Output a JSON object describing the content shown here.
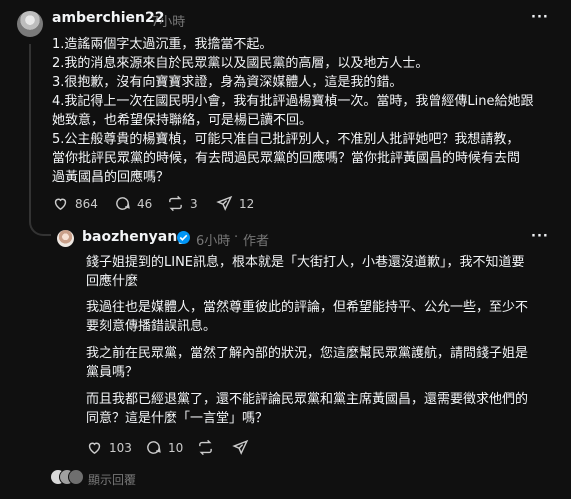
{
  "post": {
    "username": "amberchien22",
    "time": "7小時",
    "more_label": "···",
    "lines": [
      "1.造謠兩個字太過沉重，我擔當不起。",
      "2.我的消息來源來自於民眾黨以及國民黨的高層，以及地方人士。",
      "3.很抱歉，沒有向寶寶求證，身為資深媒體人，這是我的錯。",
      "4.我記得上一次在國民明小會，我有批評過楊寶楨一次。當時，我曾經傳Line給她跟",
      "她致意，也希望保持聯絡，可是楊已讀不回。",
      "5.公主般尊貴的楊寶楨，可能只准自己批評別人，不准別人批評她吧？我想請教，",
      "當你批評民眾黨的時候，有去問過民眾黨的回應嗎？當你批評黃國昌的時候有去問",
      "過黃國昌的回應嗎？"
    ],
    "actions": {
      "likes": "864",
      "comments": "46",
      "reposts": "3",
      "shares": "12"
    }
  },
  "reply": {
    "username": "baozhenyang",
    "time": "6小時",
    "author_tag": "作者",
    "more_label": "···",
    "paragraphs": [
      [
        "錢子姐提到的LINE訊息，根本就是「大街打人，小巷還沒道歉」，我不知道要",
        "回應什麼"
      ],
      [
        "我過往也是媒體人，當然尊重彼此的評論，但希望能持平、公允一些，至少不",
        "要刻意傳播錯誤訊息。"
      ],
      [
        "我之前在民眾黨，當然了解內部的狀況，您這麼幫民眾黨護航，請問錢子姐是",
        "黨員嗎？"
      ],
      [
        "而且我都已經退黨了，還不能評論民眾黨和黨主席黃國昌，還需要徵求他們的",
        "同意？這是什麼「一言堂」嗎？"
      ]
    ],
    "actions": {
      "likes": "103",
      "comments": "10"
    }
  },
  "show_replies_label": "顯示回覆",
  "colors": {
    "background": "#101010",
    "text": "#f3f5f7",
    "muted": "#777777",
    "verified": "#0095f6"
  }
}
